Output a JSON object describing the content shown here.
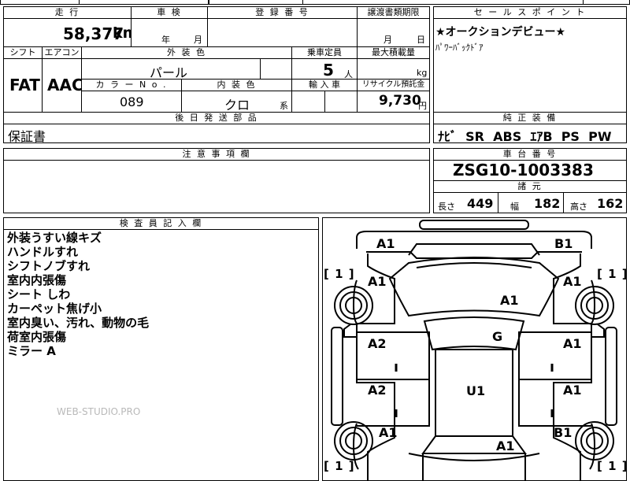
{
  "top_header": {
    "mileage_label": "走 行",
    "inspection_label": "車 検",
    "registration_label": "登 録 番 号",
    "transfer_label": "譲渡書類期限",
    "sales_point_label": "セ ー ル ス ポ イ ン ト"
  },
  "mileage": {
    "value": "58,377",
    "unit": "km"
  },
  "inspection": {
    "year_label": "年",
    "month_label": "月"
  },
  "transfer": {
    "month_label": "月",
    "day_label": "日"
  },
  "sales_point": {
    "line1": "★オークションデビュー★",
    "line2": "ﾊﾟﾜｰﾊﾞｯｸﾄﾞｱ"
  },
  "spec_header": {
    "shift_label": "シフト",
    "aircon_label": "エアコン",
    "exterior_color_label": "外 装 色",
    "capacity_label": "乗車定員",
    "max_load_label": "最大積載量"
  },
  "spec": {
    "shift": "FAT",
    "aircon": "AAC",
    "exterior_color": "パール",
    "capacity": "5",
    "capacity_unit": "人",
    "max_load_unit": "kg",
    "color_no_label": "カ ラ ー N o .",
    "interior_color_label": "内 装 色",
    "import_label": "輸 入 車",
    "recycle_label": "リサイクル預託金",
    "color_no": "089",
    "interior_color": "クロ",
    "interior_suffix": "系",
    "recycle_fee": "9,730",
    "recycle_unit": "円"
  },
  "parts": {
    "label": "後 日 発 送 部 品",
    "value": "保証書"
  },
  "equipment": {
    "label": "純 正 装 備",
    "value": "ﾅﾋﾞ  SR  ABS  ｴｱB  PS  PW"
  },
  "caution": {
    "label": "注 意 事 項 欄"
  },
  "chassis": {
    "label": "車 台 番 号",
    "value": "ZSG10-1003383"
  },
  "dimensions": {
    "label": "諸 元",
    "length_label": "長さ",
    "length": "449",
    "width_label": "幅",
    "width": "182",
    "height_label": "高さ",
    "height": "162"
  },
  "inspector": {
    "label": "検 査 員 記 入 欄",
    "notes": [
      "外装うすい線キズ",
      "ハンドルすれ",
      "シフトノブすれ",
      "室内内張傷",
      "シート しわ",
      "カーペット焦げ小",
      "室内臭い、汚れ、動物の毛",
      "荷室内張傷",
      "ミラー A"
    ]
  },
  "watermark": "WEB-STUDIO.PRO",
  "diagram": {
    "front_left": "A1",
    "front_right": "B1",
    "tire_fl": "1",
    "tire_fr": "1",
    "tire_rl": "1",
    "tire_rr": "1",
    "fender_fl": "A1",
    "fender_fr": "A1",
    "hood": "A1",
    "glass": "G",
    "door_fl": "A2",
    "door_fr": "A1",
    "door_rl": "A2",
    "door_rr": "A1",
    "roof": "U1",
    "quarter_rl": "A1",
    "quarter_rr": "B1",
    "rear": "A1"
  }
}
